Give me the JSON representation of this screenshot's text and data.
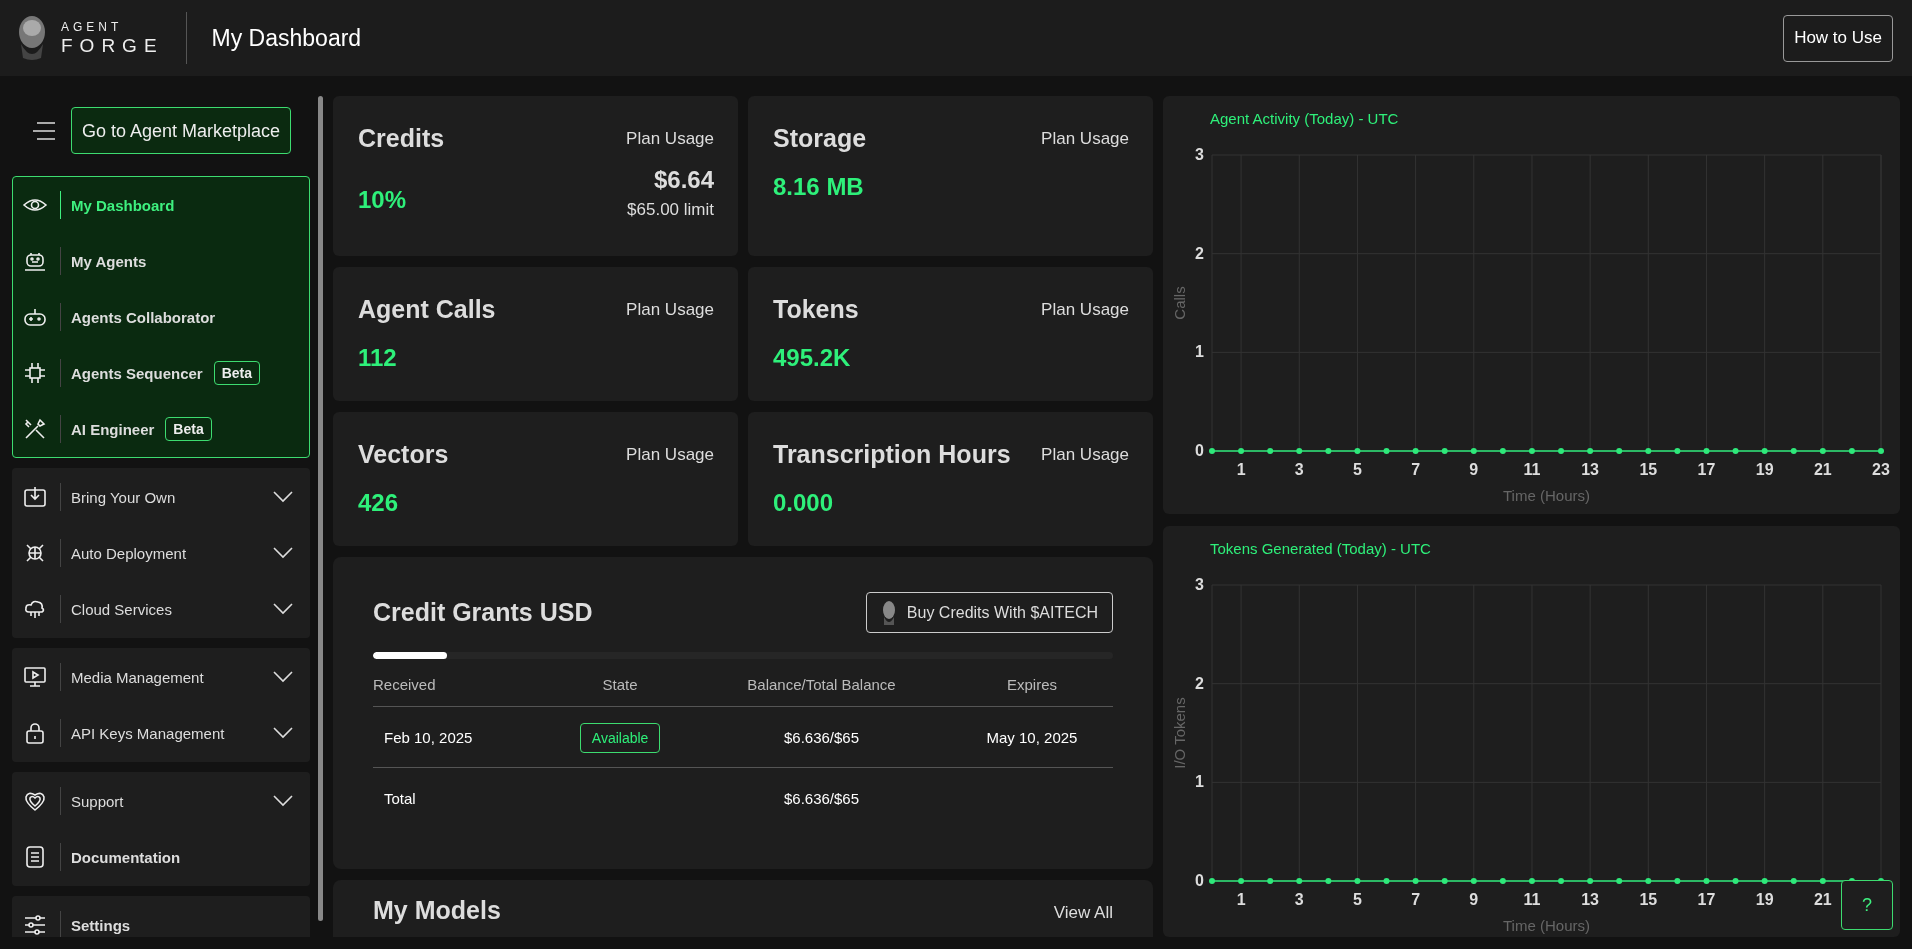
{
  "header": {
    "logo_top": "AGENT",
    "logo_bottom": "FORGE",
    "title": "My Dashboard",
    "help_button": "How to Use"
  },
  "sidebar": {
    "marketplace_button": "Go to Agent Marketplace",
    "groups": [
      {
        "highlighted": true,
        "items": [
          {
            "label": "My Dashboard",
            "kind": "link",
            "selected": true
          },
          {
            "label": "My Agents",
            "kind": "link",
            "selected": false
          },
          {
            "label": "Agents Collaborator",
            "kind": "link",
            "selected": false
          },
          {
            "label": "Agents Sequencer",
            "kind": "link",
            "selected": false,
            "badge": "Beta"
          },
          {
            "label": "AI Engineer",
            "kind": "link",
            "selected": false,
            "badge": "Beta"
          }
        ]
      },
      {
        "highlighted": false,
        "items": [
          {
            "label": "Bring Your Own",
            "kind": "dropdown",
            "selected": false,
            "expanded": false
          },
          {
            "label": "Auto Deployment",
            "kind": "dropdown",
            "selected": false,
            "expanded": false
          },
          {
            "label": "Cloud Services",
            "kind": "dropdown",
            "selected": false,
            "expanded": false
          }
        ]
      },
      {
        "highlighted": false,
        "items": [
          {
            "label": "Media Management",
            "kind": "dropdown",
            "selected": false,
            "expanded": false
          },
          {
            "label": "API Keys Management",
            "kind": "dropdown",
            "selected": false,
            "expanded": false
          }
        ]
      },
      {
        "highlighted": false,
        "items": [
          {
            "label": "Support",
            "kind": "dropdown",
            "selected": false,
            "expanded": false
          },
          {
            "label": "Documentation",
            "kind": "link",
            "selected": false
          }
        ]
      },
      {
        "highlighted": false,
        "items": [
          {
            "label": "Settings",
            "kind": "link",
            "selected": false
          }
        ]
      }
    ]
  },
  "usage_cards": [
    {
      "title": "Credits",
      "plan_label": "Plan Usage",
      "value": "10%",
      "amount": "$6.64",
      "limit": "$65.00 limit"
    },
    {
      "title": "Storage",
      "plan_label": "Plan Usage",
      "value": "8.16 MB"
    },
    {
      "title": "Agent Calls",
      "plan_label": "Plan Usage",
      "value": "112"
    },
    {
      "title": "Tokens",
      "plan_label": "Plan Usage",
      "value": "495.2K"
    },
    {
      "title": "Vectors",
      "plan_label": "Plan Usage",
      "value": "426"
    },
    {
      "title": "Transcription Hours",
      "plan_label": "Plan Usage",
      "value": "0.000"
    }
  ],
  "credit_grants": {
    "title": "Credit Grants USD",
    "buy_button": "Buy Credits With $AITECH",
    "level": 0.1,
    "columns": [
      "Received",
      "State",
      "Balance/Total Balance",
      "Expires"
    ],
    "rows": [
      {
        "received": "Feb 10, 2025",
        "state": "Available",
        "balance": "$6.636/$65",
        "expires": "May 10, 2025"
      }
    ],
    "total": {
      "label": "Total",
      "balance": "$6.636/$65"
    }
  },
  "models": {
    "title": "My Models",
    "view_all": "View All"
  },
  "charts": [
    {
      "title": "Agent Activity (Today) - UTC",
      "chart_data": {
        "type": "line",
        "xlabel": "Time (Hours)",
        "grid": true,
        "xlim": [
          0,
          23
        ],
        "x": [
          0,
          1,
          2,
          3,
          4,
          5,
          6,
          7,
          8,
          9,
          10,
          11,
          12,
          13,
          14,
          15,
          16,
          17,
          18,
          19,
          20,
          21,
          22,
          23
        ],
        "xticks": [
          1,
          3,
          5,
          7,
          9,
          11,
          13,
          15,
          17,
          19,
          21,
          23
        ],
        "yticks": [
          0,
          1,
          2,
          3
        ],
        "ylim": [
          0,
          3
        ],
        "series": [
          {
            "name": "Calls",
            "color": "#2ee87a",
            "marker": "circle",
            "values": [
              0,
              0,
              0,
              0,
              0,
              0,
              0,
              0,
              0,
              0,
              0,
              0,
              0,
              0,
              0,
              0,
              0,
              0,
              0,
              0,
              0,
              0,
              0,
              0
            ]
          }
        ]
      }
    },
    {
      "title": "Tokens Generated (Today) - UTC",
      "chart_data": {
        "type": "line",
        "xlabel": "Time (Hours)",
        "grid": true,
        "xlim": [
          0,
          23
        ],
        "x": [
          0,
          1,
          2,
          3,
          4,
          5,
          6,
          7,
          8,
          9,
          10,
          11,
          12,
          13,
          14,
          15,
          16,
          17,
          18,
          19,
          20,
          21,
          22,
          23
        ],
        "xticks": [
          1,
          3,
          5,
          7,
          9,
          11,
          13,
          15,
          17,
          19,
          21
        ],
        "yticks": [
          0,
          1,
          2,
          3
        ],
        "ylim": [
          0,
          3
        ],
        "series": [
          {
            "name": "I/O Tokens",
            "color": "#2ee87a",
            "marker": "circle",
            "values": [
              0,
              0,
              0,
              0,
              0,
              0,
              0,
              0,
              0,
              0,
              0,
              0,
              0,
              0,
              0,
              0,
              0,
              0,
              0,
              0,
              0,
              0,
              0,
              0
            ]
          }
        ]
      }
    }
  ],
  "help_fab": "?"
}
